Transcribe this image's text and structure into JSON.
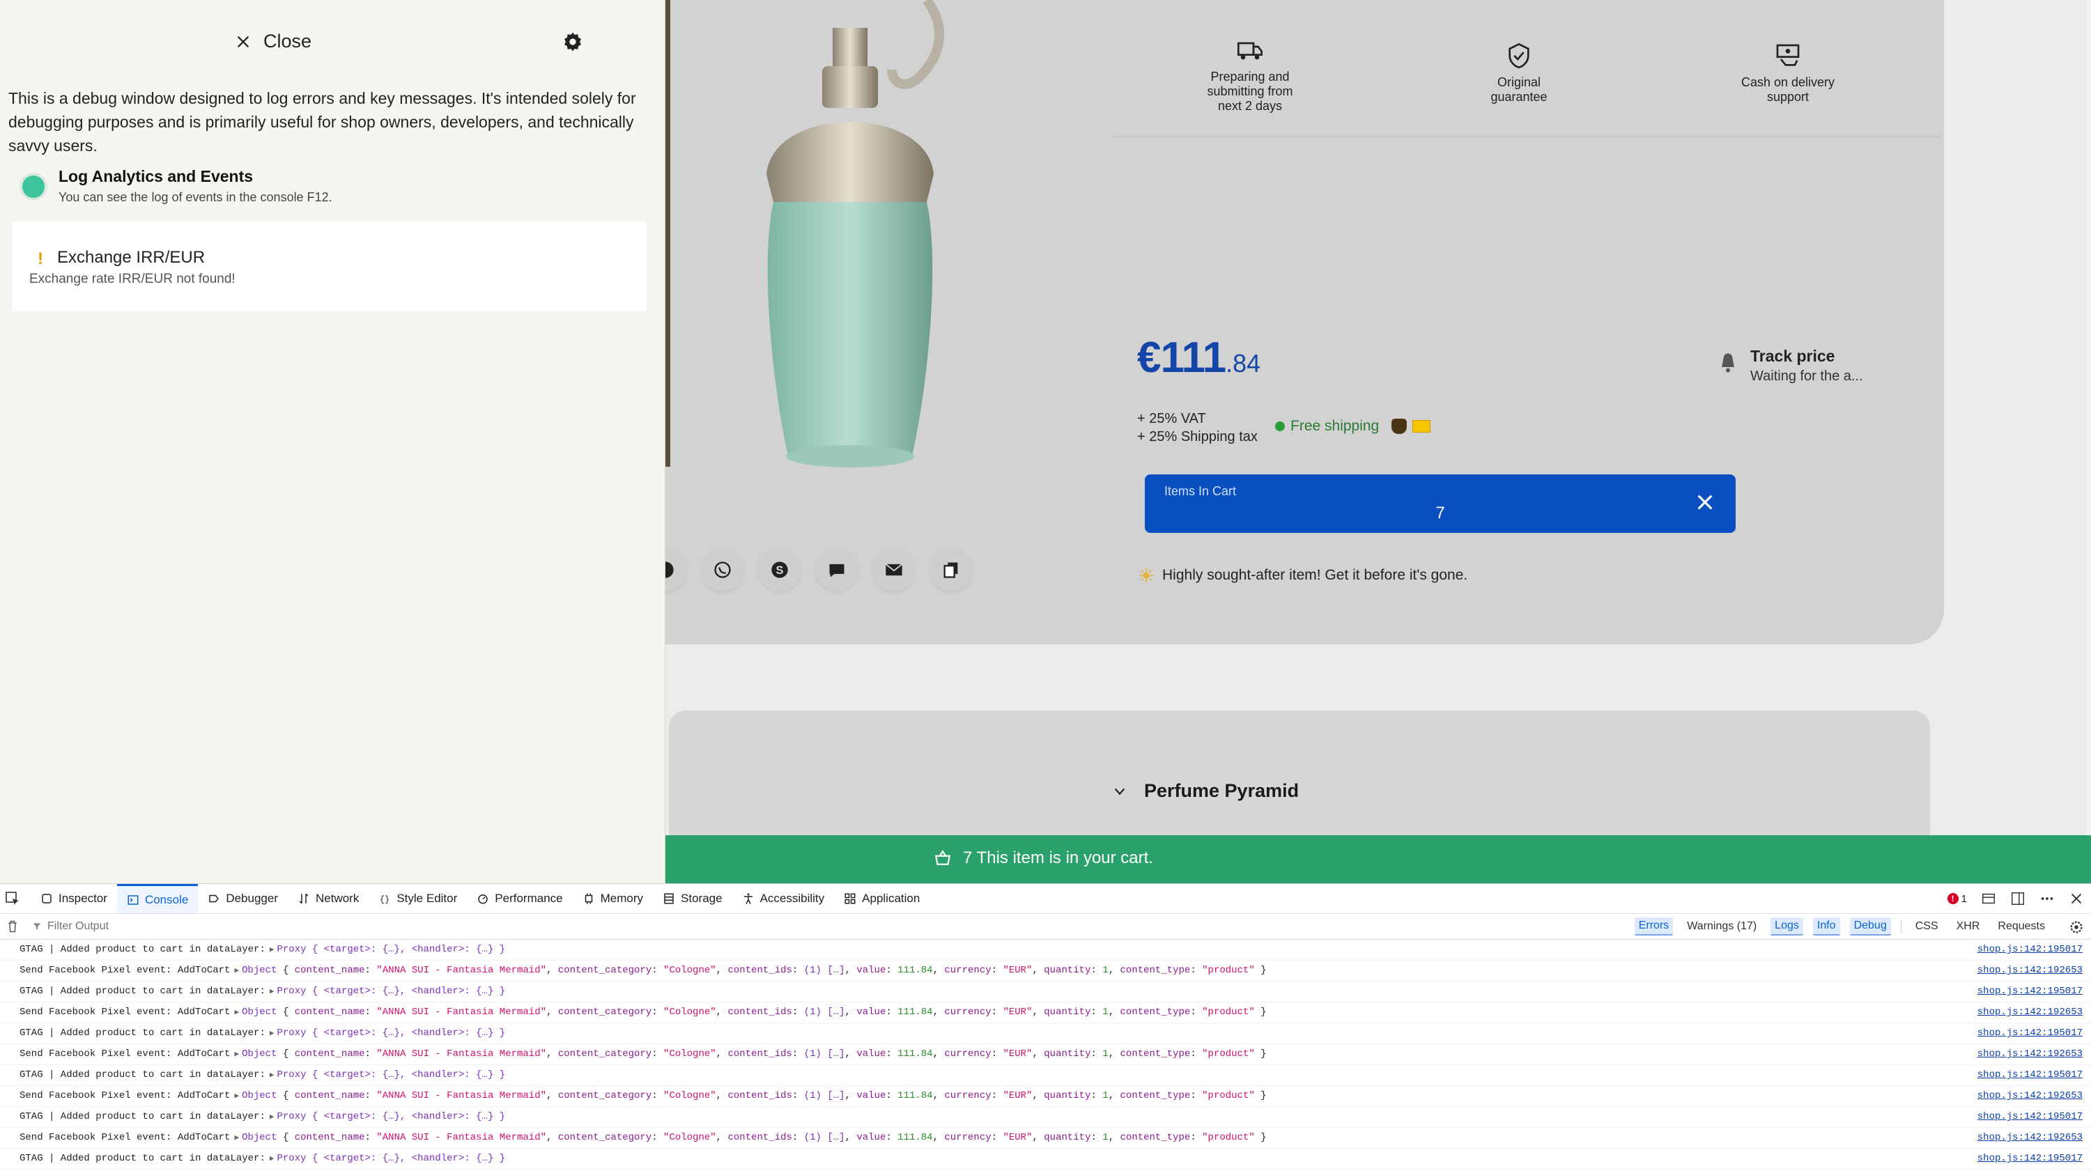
{
  "debug_panel": {
    "close_label": "Close",
    "description": "This is a debug window designed to log errors and key messages. It's intended solely for debugging purposes and is primarily useful for shop owners, developers, and technically savvy users.",
    "option": {
      "title": "Log Analytics and Events",
      "subtitle": "You can see the log of events in the console F12.",
      "enabled": true
    },
    "message": {
      "title": "Exchange IRR/EUR",
      "body": "Exchange rate IRR/EUR not found!"
    }
  },
  "product": {
    "features": [
      {
        "label": "Preparing and submitting from next 2 days",
        "icon": "delivery-truck-icon"
      },
      {
        "label": "Original guarantee",
        "icon": "shield-badge-icon"
      },
      {
        "label": "Cash on delivery support",
        "icon": "cash-hand-icon"
      }
    ],
    "price_main": "€111",
    "price_cents": ".84",
    "vat": "+ 25% VAT",
    "shipping_tax": "+ 25% Shipping tax",
    "free_shipping": "Free shipping",
    "track_title": "Track price",
    "track_sub": "Waiting for the a...",
    "cart_label": "Items In Cart",
    "cart_qty": "7",
    "sought": "Highly sought-after item! Get it before it's gone.",
    "pyramid_title": "Perfume Pyramid",
    "share_icons": [
      "messenger-icon",
      "whatsapp-icon",
      "skype-icon",
      "sms-icon",
      "email-icon",
      "copy-icon"
    ],
    "colors": {
      "accent": "#0a4fbf",
      "price": "#1446a8",
      "cart_bar": "#2aa06b",
      "toggle": "#3cc59a"
    }
  },
  "cart_bar": {
    "text": "7 This item is in your cart."
  },
  "devtools": {
    "tabs": [
      {
        "label": "Inspector",
        "icon": "inspector-icon"
      },
      {
        "label": "Console",
        "icon": "console-icon",
        "active": true
      },
      {
        "label": "Debugger",
        "icon": "debugger-icon"
      },
      {
        "label": "Network",
        "icon": "network-icon"
      },
      {
        "label": "Style Editor",
        "icon": "style-editor-icon"
      },
      {
        "label": "Performance",
        "icon": "performance-icon"
      },
      {
        "label": "Memory",
        "icon": "memory-icon"
      },
      {
        "label": "Storage",
        "icon": "storage-icon"
      },
      {
        "label": "Accessibility",
        "icon": "accessibility-icon"
      },
      {
        "label": "Application",
        "icon": "application-icon"
      }
    ],
    "error_count": "1",
    "filter_placeholder": "Filter Output",
    "levels": {
      "errors": "Errors",
      "warnings": "Warnings (17)",
      "logs": "Logs",
      "info": "Info",
      "debug": "Debug",
      "css": "CSS",
      "xhr": "XHR",
      "requests": "Requests"
    },
    "log": {
      "gtag_msg": "GTAG | Added product to cart in dataLayer:",
      "gtag_obj": "Proxy",
      "gtag_body": "{ <target>: {…}, <handler>: {…} }",
      "gtag_src": "shop.js:142:195017",
      "fb_msg": "Send Facebook Pixel event: AddToCart",
      "fb_obj": "Object",
      "fb_src": "shop.js:142:192653",
      "fb_fields": [
        {
          "key": "content_name",
          "val": "\"ANNA SUI - Fantasia Mermaid\"",
          "type": "str"
        },
        {
          "key": "content_category",
          "val": "\"Cologne\"",
          "type": "str"
        },
        {
          "key": "content_ids",
          "val": "(1) […]",
          "type": "plain"
        },
        {
          "key": "value",
          "val": "111.84",
          "type": "num"
        },
        {
          "key": "currency",
          "val": "\"EUR\"",
          "type": "str"
        },
        {
          "key": "quantity",
          "val": "1",
          "type": "num"
        },
        {
          "key": "content_type",
          "val": "\"product\"",
          "type": "str"
        }
      ],
      "row_pattern": [
        "gtag",
        "fb",
        "gtag",
        "fb",
        "gtag",
        "fb",
        "gtag",
        "fb",
        "gtag",
        "fb",
        "gtag"
      ]
    }
  }
}
